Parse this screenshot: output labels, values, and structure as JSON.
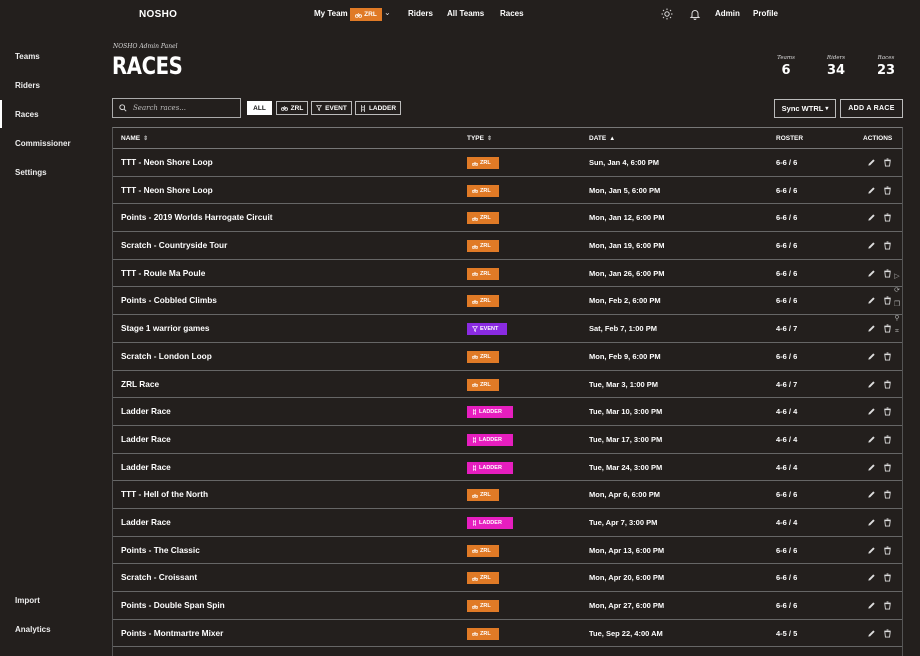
{
  "header": {
    "logo": "NOSHO",
    "my_team": "My Team",
    "team_badge": "ZRL",
    "nav": {
      "riders": "Riders",
      "all_teams": "All Teams",
      "races": "Races"
    },
    "admin": "Admin",
    "profile": "Profile"
  },
  "sidebar": {
    "items": [
      "Teams",
      "Riders",
      "Races",
      "Commissioner",
      "Settings"
    ],
    "bottom_items": [
      "Import",
      "Analytics"
    ],
    "active": "Races"
  },
  "page": {
    "panel_label": "NOSHO Admin Panel",
    "title": "RACES",
    "stats": [
      {
        "label": "Teams",
        "value": "6"
      },
      {
        "label": "Riders",
        "value": "34"
      },
      {
        "label": "Races",
        "value": "23"
      }
    ]
  },
  "toolbar": {
    "search_placeholder": "Search races...",
    "filters": [
      "ALL",
      "ZRL",
      "EVENT",
      "LADDER"
    ],
    "active_filter": "ALL",
    "sync_label": "Sync WTRL",
    "add_label": "ADD A RACE"
  },
  "table": {
    "headers": {
      "name": "NAME",
      "type": "TYPE",
      "date": "DATE",
      "roster": "ROSTER",
      "actions": "ACTIONS"
    },
    "rows": [
      {
        "name": "TTT - Neon Shore Loop",
        "type": "ZRL",
        "date": "Sun, Jan 4, 6:00 PM",
        "roster": "6-6 / 6"
      },
      {
        "name": "TTT - Neon Shore Loop",
        "type": "ZRL",
        "date": "Mon, Jan 5, 6:00 PM",
        "roster": "6-6 / 6"
      },
      {
        "name": "Points - 2019 Worlds Harrogate Circuit",
        "type": "ZRL",
        "date": "Mon, Jan 12, 6:00 PM",
        "roster": "6-6 / 6"
      },
      {
        "name": "Scratch - Countryside Tour",
        "type": "ZRL",
        "date": "Mon, Jan 19, 6:00 PM",
        "roster": "6-6 / 6"
      },
      {
        "name": "TTT - Roule Ma Poule",
        "type": "ZRL",
        "date": "Mon, Jan 26, 6:00 PM",
        "roster": "6-6 / 6"
      },
      {
        "name": "Points - Cobbled Climbs",
        "type": "ZRL",
        "date": "Mon, Feb 2, 6:00 PM",
        "roster": "6-6 / 6"
      },
      {
        "name": "Stage 1 warrior games",
        "type": "EVENT",
        "date": "Sat, Feb 7, 1:00 PM",
        "roster": "4-6 / 7"
      },
      {
        "name": "Scratch - London Loop",
        "type": "ZRL",
        "date": "Mon, Feb 9, 6:00 PM",
        "roster": "6-6 / 6"
      },
      {
        "name": "ZRL Race",
        "type": "ZRL",
        "date": "Tue, Mar 3, 1:00 PM",
        "roster": "4-6 / 7"
      },
      {
        "name": "Ladder Race",
        "type": "LADDER",
        "date": "Tue, Mar 10, 3:00 PM",
        "roster": "4-6 / 4"
      },
      {
        "name": "Ladder Race",
        "type": "LADDER",
        "date": "Tue, Mar 17, 3:00 PM",
        "roster": "4-6 / 4"
      },
      {
        "name": "Ladder Race",
        "type": "LADDER",
        "date": "Tue, Mar 24, 3:00 PM",
        "roster": "4-6 / 4"
      },
      {
        "name": "TTT - Hell of the North",
        "type": "ZRL",
        "date": "Mon, Apr 6, 6:00 PM",
        "roster": "6-6 / 6"
      },
      {
        "name": "Ladder Race",
        "type": "LADDER",
        "date": "Tue, Apr 7, 3:00 PM",
        "roster": "4-6 / 4"
      },
      {
        "name": "Points - The Classic",
        "type": "ZRL",
        "date": "Mon, Apr 13, 6:00 PM",
        "roster": "6-6 / 6"
      },
      {
        "name": "Scratch - Croissant",
        "type": "ZRL",
        "date": "Mon, Apr 20, 6:00 PM",
        "roster": "6-6 / 6"
      },
      {
        "name": "Points - Double Span Spin",
        "type": "ZRL",
        "date": "Mon, Apr 27, 6:00 PM",
        "roster": "6-6 / 6"
      },
      {
        "name": "Points - Montmartre Mixer",
        "type": "ZRL",
        "date": "Tue, Sep 22, 4:00 AM",
        "roster": "4-5 / 5"
      }
    ]
  },
  "colors": {
    "zrl": "#e07a26",
    "event": "#8a2be2",
    "ladder": "#e61ebf",
    "background": "#231f1d"
  }
}
